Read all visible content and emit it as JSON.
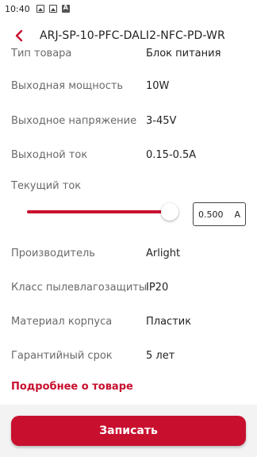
{
  "status_bar": {
    "time": "10:40"
  },
  "header": {
    "title": "ARJ-SP-10-PFC-DALI2-NFC-PD-WR"
  },
  "specs": [
    {
      "label": "Тип товара",
      "value": "Блок питания"
    },
    {
      "label": "Выходная мощность",
      "value": "10W"
    },
    {
      "label": "Выходное напряжение",
      "value": "3-45V"
    },
    {
      "label": "Выходной ток",
      "value": "0.15-0.5A"
    }
  ],
  "current": {
    "label": "Текущий ток",
    "value": "0.500",
    "unit": "A",
    "slider_fraction": 1.0
  },
  "specs2": [
    {
      "label": "Производитель",
      "value": "Arlight"
    },
    {
      "label": "Класс пылевлагозащиты",
      "value": "IP20"
    },
    {
      "label": "Материал корпуса",
      "value": "Пластик"
    },
    {
      "label": "Гарантийный срок",
      "value": "5 лет"
    }
  ],
  "more_link": "Подробнее о товаре",
  "submit_label": "Записать",
  "colors": {
    "accent": "#c8102e"
  }
}
